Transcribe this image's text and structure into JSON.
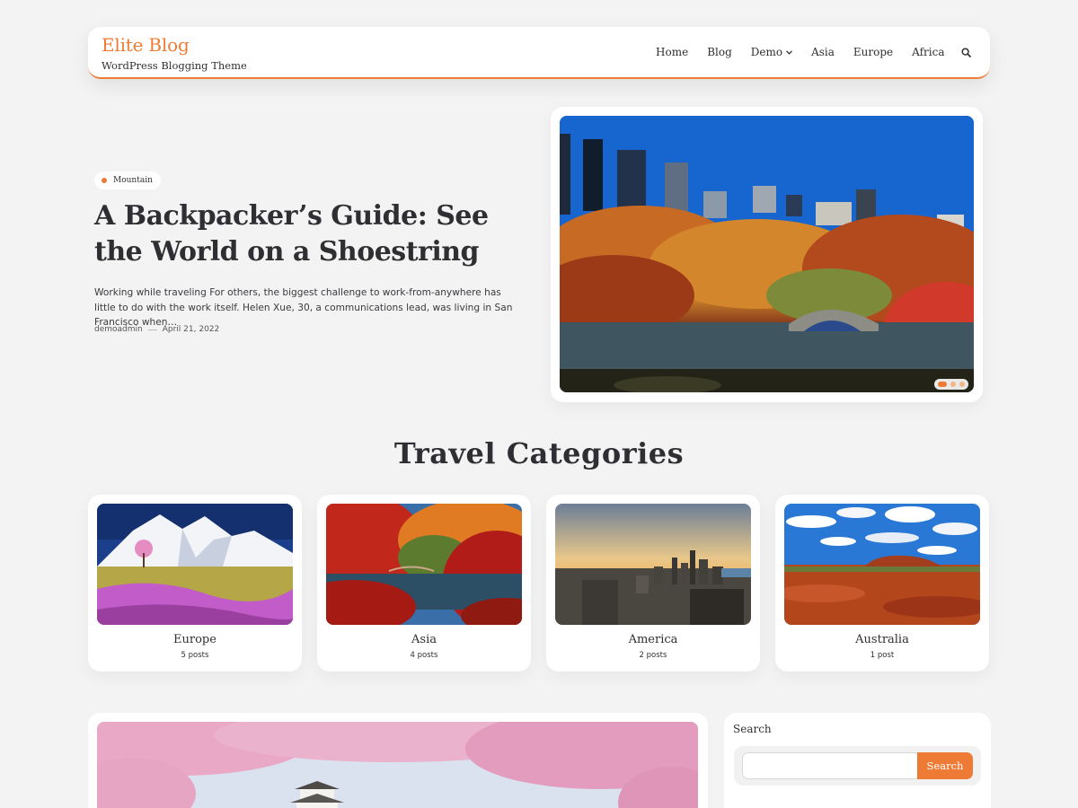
{
  "site": {
    "title": "Elite Blog",
    "tagline": "WordPress Blogging Theme",
    "accent_color": "#ee7b35"
  },
  "nav": {
    "items": [
      "Home",
      "Blog",
      "Demo",
      "Asia",
      "Europe",
      "Africa"
    ],
    "search_icon": "search-icon",
    "demo_icon": "chevron-down-icon"
  },
  "hero": {
    "category": "Mountain",
    "title": "A Backpacker’s Guide: See the World on a Shoestring",
    "excerpt": "Working while traveling For others, the biggest challenge to work-from-anywhere has little to do with the work itself. Helen Xue, 30, a communications lead, was living in San Francisco when…",
    "author": "demoadmin",
    "date": "April 21, 2022",
    "slider_active": 1,
    "slider_total": 3
  },
  "categories_section": {
    "title": "Travel Categories",
    "items": [
      {
        "name": "Europe",
        "count": "5 posts"
      },
      {
        "name": "Asia",
        "count": "4 posts"
      },
      {
        "name": "America",
        "count": "2 posts"
      },
      {
        "name": "Australia",
        "count": "1 post"
      }
    ]
  },
  "sidebar": {
    "search_widget_title": "Search",
    "search_value": "",
    "search_button": "Search"
  }
}
